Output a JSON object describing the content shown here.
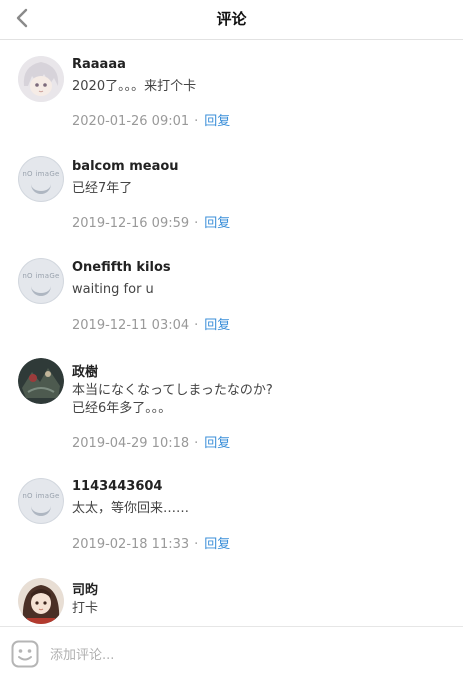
{
  "header": {
    "title": "评论"
  },
  "comments": [
    {
      "name": "Raaaaa",
      "text_lines": [
        "2020了。。。来打个卡"
      ],
      "time": "2020-01-26 09:01",
      "reply": "回复",
      "avatar": "anime-girl-avatar"
    },
    {
      "name": "balcom meaou",
      "text_lines": [
        "已经7年了"
      ],
      "time": "2019-12-16 09:59",
      "reply": "回复",
      "avatar": "no-image-avatar"
    },
    {
      "name": "Onefifth kilos",
      "text_lines": [
        "waiting for u"
      ],
      "time": "2019-12-11 03:04",
      "reply": "回复",
      "avatar": "no-image-avatar"
    },
    {
      "name": "政樹",
      "text_lines": [
        "本当になくなってしまったなのか?",
        "已经6年多了。。。"
      ],
      "time": "2019-04-29 10:18",
      "reply": "回复",
      "avatar": "dark-art-avatar"
    },
    {
      "name": "1143443604",
      "text_lines": [
        "太太，等你回来……"
      ],
      "time": "2019-02-18 11:33",
      "reply": "回复",
      "avatar": "no-image-avatar"
    },
    {
      "name": "司昀",
      "text_lines": [
        "打卡"
      ],
      "time": "",
      "reply": "",
      "avatar": "anime-girl-brown-avatar"
    }
  ],
  "no_image_label": "nO imaGe",
  "composer": {
    "placeholder": "添加评论..."
  },
  "colors": {
    "accent": "#3b8fd9",
    "meta": "#999999"
  }
}
